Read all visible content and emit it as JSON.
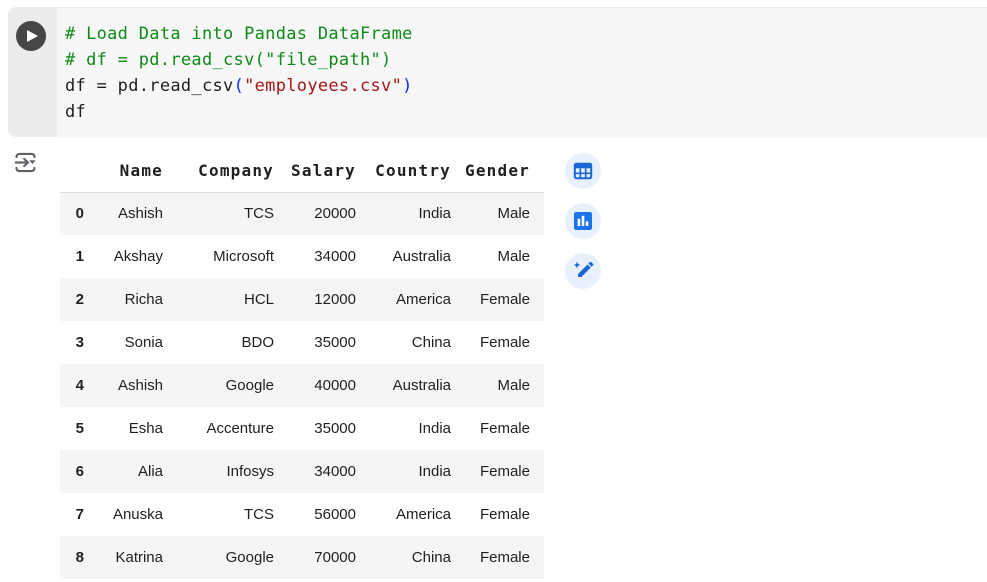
{
  "colors": {
    "cell_bg": "#f7f7f7",
    "gutter_bg": "#ececec",
    "run_button": "#444746",
    "code_text": "#1f1f1f",
    "comment": "#0e8a16",
    "string": "#a31515",
    "bracket": "#0431fa",
    "table_text": "#1f1f1f",
    "stripe": "#f5f5f5",
    "header_border": "#d9d9d9",
    "circle_bg": "#e8f0fe",
    "icon_blue": "#1967d2",
    "chart_blue": "#1a73e8",
    "muted_icon": "#5f6368"
  },
  "cell": {
    "code_lines": [
      [
        {
          "t": "comment",
          "s": "# Load Data into Pandas DataFrame"
        }
      ],
      [
        {
          "t": "comment",
          "s": "# df = pd.read_csv(\"file_path\")"
        }
      ],
      [
        {
          "t": "plain",
          "s": "df = pd.read_csv"
        },
        {
          "t": "bracket",
          "s": "("
        },
        {
          "t": "string",
          "s": "\"employees.csv\""
        },
        {
          "t": "bracket",
          "s": ")"
        }
      ],
      [
        {
          "t": "plain",
          "s": "df"
        }
      ]
    ]
  },
  "output": {
    "gutter_icon": "output-options-icon",
    "table": {
      "index_header": "",
      "columns": [
        "Name",
        "Company",
        "Salary",
        "Country",
        "Gender"
      ],
      "rows": [
        {
          "index": "0",
          "cells": [
            "Ashish",
            "TCS",
            "20000",
            "India",
            "Male"
          ]
        },
        {
          "index": "1",
          "cells": [
            "Akshay",
            "Microsoft",
            "34000",
            "Australia",
            "Male"
          ]
        },
        {
          "index": "2",
          "cells": [
            "Richa",
            "HCL",
            "12000",
            "America",
            "Female"
          ]
        },
        {
          "index": "3",
          "cells": [
            "Sonia",
            "BDO",
            "35000",
            "China",
            "Female"
          ]
        },
        {
          "index": "4",
          "cells": [
            "Ashish",
            "Google",
            "40000",
            "Australia",
            "Male"
          ]
        },
        {
          "index": "5",
          "cells": [
            "Esha",
            "Accenture",
            "35000",
            "India",
            "Female"
          ]
        },
        {
          "index": "6",
          "cells": [
            "Alia",
            "Infosys",
            "34000",
            "India",
            "Female"
          ]
        },
        {
          "index": "7",
          "cells": [
            "Anuska",
            "TCS",
            "56000",
            "America",
            "Female"
          ]
        },
        {
          "index": "8",
          "cells": [
            "Katrina",
            "Google",
            "70000",
            "China",
            "Female"
          ]
        }
      ]
    },
    "toolbar_icons": [
      "table-icon",
      "bar-chart-icon",
      "edit-sparkle-icon"
    ]
  }
}
